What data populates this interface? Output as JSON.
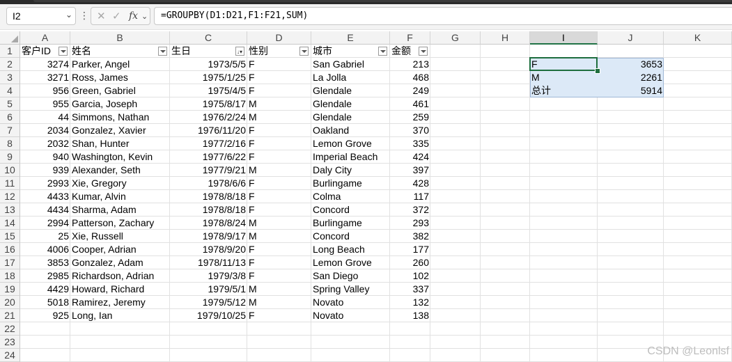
{
  "name_box": "I2",
  "formula": "=GROUPBY(D1:D21,F1:F21,SUM)",
  "columns": [
    "A",
    "B",
    "C",
    "D",
    "E",
    "F",
    "G",
    "H",
    "I",
    "J",
    "K"
  ],
  "rows": [
    "1",
    "2",
    "3",
    "4",
    "5",
    "6",
    "7",
    "8",
    "9",
    "10",
    "11",
    "12",
    "13",
    "14",
    "15",
    "16",
    "17",
    "18",
    "19",
    "20",
    "21",
    "22",
    "23",
    "24"
  ],
  "headers": [
    "客户ID",
    "姓名",
    "生日",
    "性别",
    "城市",
    "金额"
  ],
  "table": [
    [
      "3274",
      "Parker, Angel",
      "1973/5/5",
      "F",
      "San Gabriel",
      "213"
    ],
    [
      "3271",
      "Ross, James",
      "1975/1/25",
      "F",
      "La Jolla",
      "468"
    ],
    [
      "956",
      "Green, Gabriel",
      "1975/4/5",
      "F",
      "Glendale",
      "249"
    ],
    [
      "955",
      "Garcia, Joseph",
      "1975/8/17",
      "M",
      "Glendale",
      "461"
    ],
    [
      "44",
      "Simmons, Nathan",
      "1976/2/24",
      "M",
      "Glendale",
      "259"
    ],
    [
      "2034",
      "Gonzalez, Xavier",
      "1976/11/20",
      "F",
      "Oakland",
      "370"
    ],
    [
      "2032",
      "Shan, Hunter",
      "1977/2/16",
      "F",
      "Lemon Grove",
      "335"
    ],
    [
      "940",
      "Washington, Kevin",
      "1977/6/22",
      "F",
      "Imperial Beach",
      "424"
    ],
    [
      "939",
      "Alexander, Seth",
      "1977/9/21",
      "M",
      "Daly City",
      "397"
    ],
    [
      "2993",
      "Xie, Gregory",
      "1978/6/6",
      "F",
      "Burlingame",
      "428"
    ],
    [
      "4433",
      "Kumar, Alvin",
      "1978/8/18",
      "F",
      "Colma",
      "117"
    ],
    [
      "4434",
      "Sharma, Adam",
      "1978/8/18",
      "F",
      "Concord",
      "372"
    ],
    [
      "2994",
      "Patterson, Zachary",
      "1978/8/24",
      "M",
      "Burlingame",
      "293"
    ],
    [
      "25",
      "Xie, Russell",
      "1978/9/17",
      "M",
      "Concord",
      "382"
    ],
    [
      "4006",
      "Cooper, Adrian",
      "1978/9/20",
      "F",
      "Long Beach",
      "177"
    ],
    [
      "3853",
      "Gonzalez, Adam",
      "1978/11/13",
      "F",
      "Lemon Grove",
      "260"
    ],
    [
      "2985",
      "Richardson, Adrian",
      "1979/3/8",
      "F",
      "San Diego",
      "102"
    ],
    [
      "4429",
      "Howard, Richard",
      "1979/5/1",
      "M",
      "Spring Valley",
      "337"
    ],
    [
      "5018",
      "Ramirez, Jeremy",
      "1979/5/12",
      "M",
      "Novato",
      "132"
    ],
    [
      "925",
      "Long, Ian",
      "1979/10/25",
      "F",
      "Novato",
      "138"
    ]
  ],
  "groupby_result": [
    [
      "F",
      "3653"
    ],
    [
      "M",
      "2261"
    ],
    [
      "总计",
      "5914"
    ]
  ],
  "watermark": "CSDN @Leonlsf",
  "colors": {
    "selection": "#1e6e3e",
    "result_fill": "#dce9f7",
    "header_bg": "#f3f3f3"
  }
}
